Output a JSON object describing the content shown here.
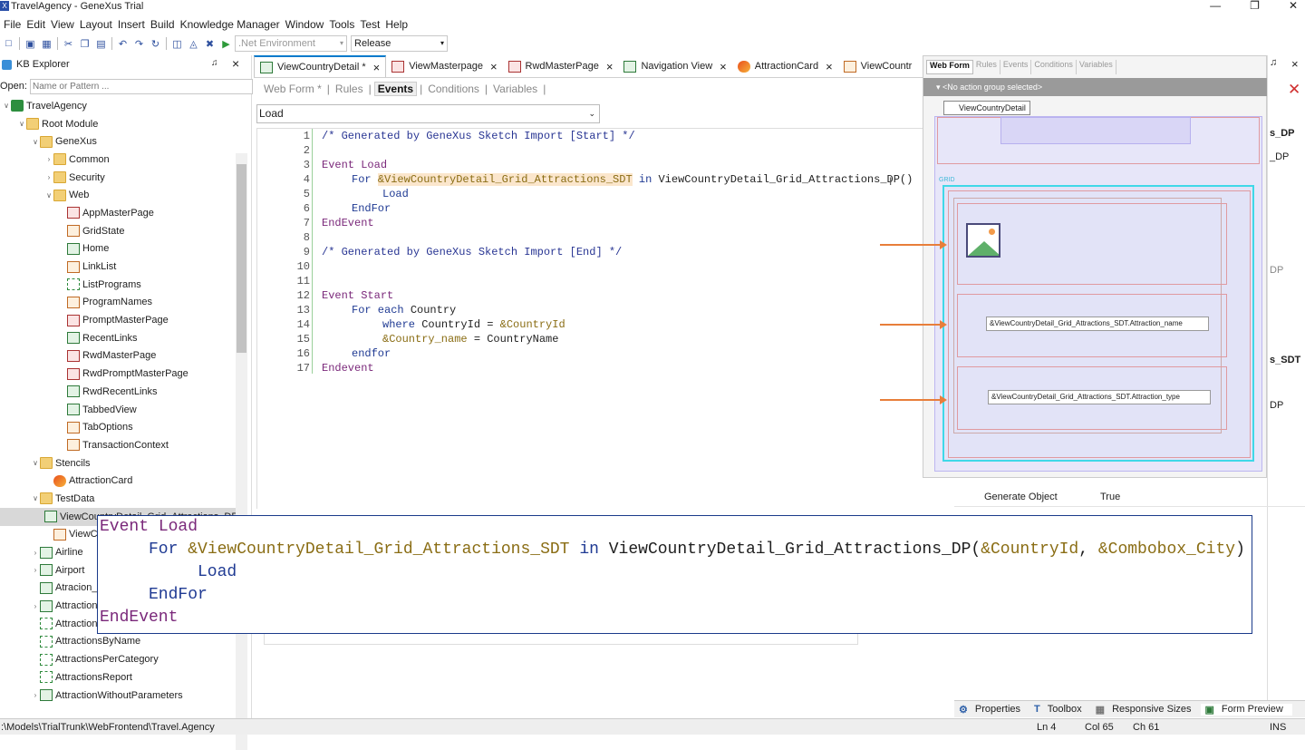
{
  "window": {
    "title": "TravelAgency - GeneXus Trial"
  },
  "menu": [
    "File",
    "Edit",
    "View",
    "Layout",
    "Insert",
    "Build",
    "Knowledge Manager",
    "Window",
    "Tools",
    "Test",
    "Help"
  ],
  "toolbar": {
    "environment": ".Net Environment",
    "configuration": "Release"
  },
  "kb": {
    "title": "KB Explorer",
    "open_label": "Open:",
    "open_placeholder": "Name or Pattern ...",
    "tree": [
      {
        "label": "TravelAgency",
        "level": 0,
        "chev": "v",
        "icon": "kb"
      },
      {
        "label": "Root Module",
        "level": 1,
        "chev": "v",
        "icon": "folder"
      },
      {
        "label": "GeneXus",
        "level": 2,
        "chev": "v",
        "icon": "folder"
      },
      {
        "label": "Common",
        "level": 3,
        "chev": ">",
        "icon": "folder"
      },
      {
        "label": "Security",
        "level": 3,
        "chev": ">",
        "icon": "folder"
      },
      {
        "label": "Web",
        "level": 3,
        "chev": "v",
        "icon": "folder"
      },
      {
        "label": "AppMasterPage",
        "level": 4,
        "chev": "",
        "icon": "obj"
      },
      {
        "label": "GridState",
        "level": 4,
        "chev": "",
        "icon": "proc"
      },
      {
        "label": "Home",
        "level": 4,
        "chev": "",
        "icon": "trn"
      },
      {
        "label": "LinkList",
        "level": 4,
        "chev": "",
        "icon": "proc"
      },
      {
        "label": "ListPrograms",
        "level": 4,
        "chev": "",
        "icon": "dp"
      },
      {
        "label": "ProgramNames",
        "level": 4,
        "chev": "",
        "icon": "proc"
      },
      {
        "label": "PromptMasterPage",
        "level": 4,
        "chev": "",
        "icon": "obj"
      },
      {
        "label": "RecentLinks",
        "level": 4,
        "chev": "",
        "icon": "trn"
      },
      {
        "label": "RwdMasterPage",
        "level": 4,
        "chev": "",
        "icon": "obj"
      },
      {
        "label": "RwdPromptMasterPage",
        "level": 4,
        "chev": "",
        "icon": "obj"
      },
      {
        "label": "RwdRecentLinks",
        "level": 4,
        "chev": "",
        "icon": "trn"
      },
      {
        "label": "TabbedView",
        "level": 4,
        "chev": "",
        "icon": "trn"
      },
      {
        "label": "TabOptions",
        "level": 4,
        "chev": "",
        "icon": "proc"
      },
      {
        "label": "TransactionContext",
        "level": 4,
        "chev": "",
        "icon": "proc"
      },
      {
        "label": "Stencils",
        "level": 2,
        "chev": "v",
        "icon": "folder"
      },
      {
        "label": "AttractionCard",
        "level": 3,
        "chev": "",
        "icon": "sten"
      },
      {
        "label": "TestData",
        "level": 2,
        "chev": "v",
        "icon": "folder"
      },
      {
        "label": "ViewCountryDetail_Grid_Attractions_DP",
        "level": 3,
        "chev": "",
        "icon": "trn",
        "selected": true
      },
      {
        "label": "ViewCou",
        "level": 3,
        "chev": "",
        "icon": "proc"
      },
      {
        "label": "Airline",
        "level": 2,
        "chev": ">",
        "icon": "trn"
      },
      {
        "label": "Airport",
        "level": 2,
        "chev": ">",
        "icon": "trn"
      },
      {
        "label": "Atracion_D",
        "level": 2,
        "chev": "",
        "icon": "trn"
      },
      {
        "label": "Attraction",
        "level": 2,
        "chev": ">",
        "icon": "trn"
      },
      {
        "label": "AttractionLi",
        "level": 2,
        "chev": "",
        "icon": "dp"
      },
      {
        "label": "AttractionsByName",
        "level": 2,
        "chev": "",
        "icon": "dp"
      },
      {
        "label": "AttractionsPerCategory",
        "level": 2,
        "chev": "",
        "icon": "dp"
      },
      {
        "label": "AttractionsReport",
        "level": 2,
        "chev": "",
        "icon": "dp"
      },
      {
        "label": "AttractionWithoutParameters",
        "level": 2,
        "chev": ">",
        "icon": "trn"
      }
    ]
  },
  "tabs": [
    {
      "label": "ViewCountryDetail *",
      "active": true,
      "icon": "trn"
    },
    {
      "label": "ViewMasterpage",
      "icon": "obj"
    },
    {
      "label": "RwdMasterPage",
      "icon": "obj"
    },
    {
      "label": "Navigation View",
      "icon": "trn"
    },
    {
      "label": "AttractionCard",
      "icon": "sten"
    },
    {
      "label": "ViewCountr",
      "icon": "proc"
    }
  ],
  "subtabs": [
    "Web Form *",
    "Rules",
    "Events",
    "Conditions",
    "Variables"
  ],
  "event_selector": "Load",
  "code": {
    "line_numbers": [
      "1",
      "2",
      "3",
      "4",
      "5",
      "6",
      "7",
      "8",
      "9",
      "10",
      "11",
      "12",
      "13",
      "14",
      "15",
      "16",
      "17"
    ],
    "l1": "/* Generated by GeneXus Sketch Import [Start] */",
    "l3a": "Event",
    "l3b": "Load",
    "l4a": "For",
    "l4b": "&ViewCountryDetail_Grid_Attractions_SDT",
    "l4c": "in",
    "l4d": "ViewCountryDetail_Grid_Attractions_DP()",
    "l5": "Load",
    "l6": "EndFor",
    "l7": "EndEvent",
    "l9": "/* Generated by GeneXus Sketch Import [End] */",
    "l12a": "Event",
    "l12b": "Start",
    "l13a": "For each",
    "l13b": "Country",
    "l14a": "where",
    "l14b": "CountryId",
    "l14c": "=",
    "l14d": "&CountryId",
    "l15a": "&Country_name",
    "l15b": "=",
    "l15c": "CountryName",
    "l16": "endfor",
    "l17": "Endevent"
  },
  "overlay": {
    "a1": "Event",
    "a2": "Load",
    "b1": "For",
    "b2": "&ViewCountryDetail_Grid_Attractions_SDT",
    "b3": "in",
    "b4": "ViewCountryDetail_Grid_Attractions_DP(",
    "b5": "&CountryId",
    ", ": ", ",
    "b6": "&Combobox_City",
    "b7": ")",
    "c": "Load",
    "d": "EndFor",
    "e": "EndEvent"
  },
  "webform": {
    "tabs": [
      "Web Form",
      "Rules",
      "Events",
      "Conditions",
      "Variables"
    ],
    "action_group": "<No action group selected>",
    "breadcrumb": "ViewCountryDetail",
    "grid_label": "GRID",
    "field_name": "&ViewCountryDetail_Grid_Attractions_SDT.Attraction_name",
    "field_type": "&ViewCountryDetail_Grid_Attractions_SDT.Attraction_type"
  },
  "rightprops": [
    "s_DP",
    "_DP",
    "DP",
    "s_SDT",
    "DP"
  ],
  "props": {
    "key": "Generate Object",
    "value": "True"
  },
  "bottomtabs": [
    "Properties",
    "Toolbox",
    "Responsive Sizes",
    "Form Preview"
  ],
  "status": {
    "path": ":\\Models\\TrialTrunk\\WebFrontend\\Travel.Agency",
    "ln": "Ln 4",
    "col": "Col 65",
    "ch": "Ch 61",
    "ins": "INS"
  }
}
